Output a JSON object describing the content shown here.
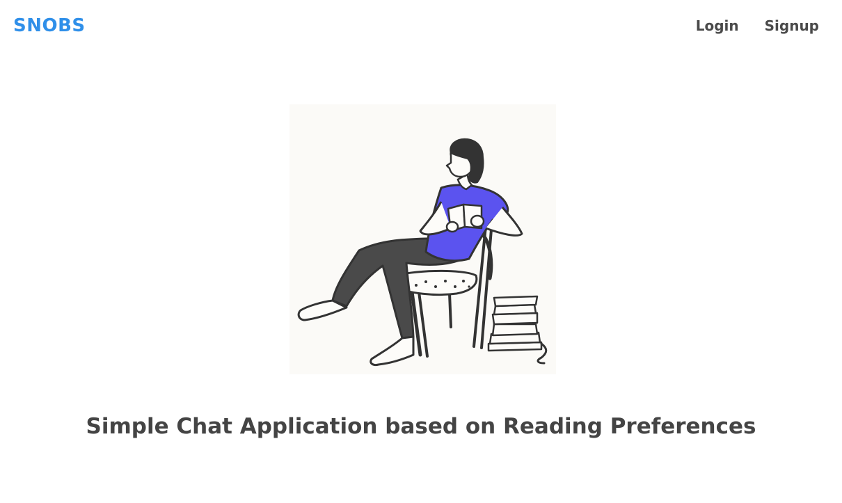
{
  "header": {
    "logo": "SNOBS",
    "nav": [
      {
        "label": "Login"
      },
      {
        "label": "Signup"
      }
    ]
  },
  "hero": {
    "illustration": "person-reading-in-chair-illustration",
    "tagline": "Simple Chat Application based on Reading Preferences"
  },
  "colors": {
    "brand": "#2f8fe9",
    "text": "#444444",
    "shirt": "#5b53ef",
    "pants": "#4a4a4a",
    "image_bg": "#fbfaf7"
  }
}
